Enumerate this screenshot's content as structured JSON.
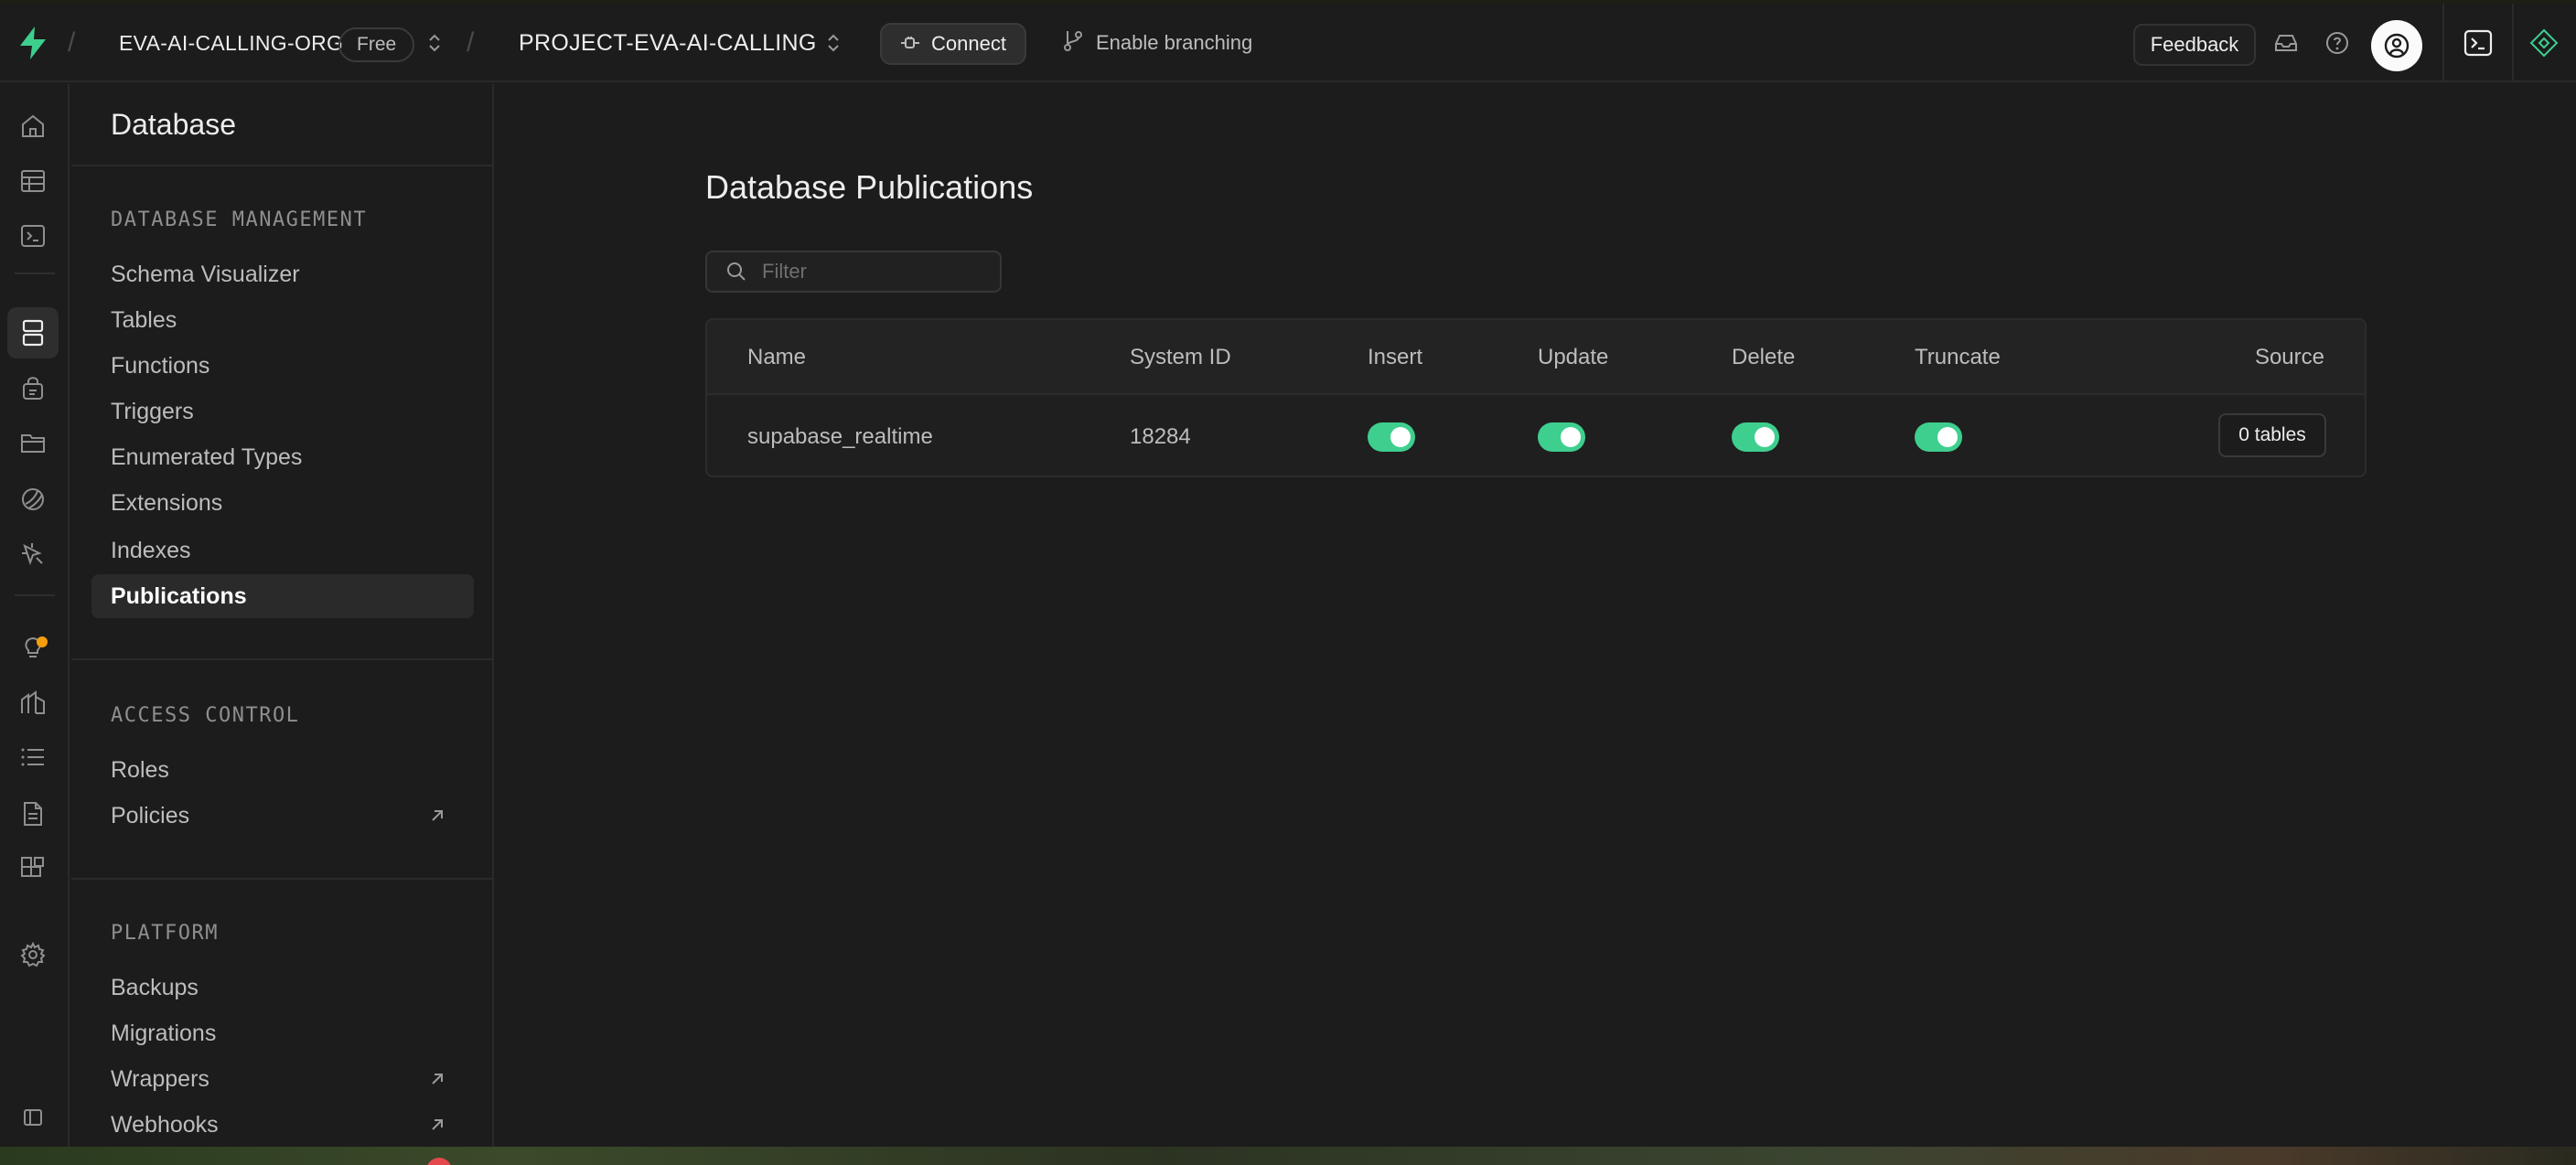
{
  "colors": {
    "accent": "#3ecf8e",
    "notification": "#f59e0b",
    "background": "#1c1c1c"
  },
  "topbar": {
    "org_name": "EVA-AI-CALLING-ORG",
    "plan_badge": "Free",
    "project_name": "PROJECT-EVA-AI-CALLING",
    "connect_label": "Connect",
    "branching_label": "Enable branching",
    "feedback_label": "Feedback"
  },
  "sidebar": {
    "title": "Database",
    "sections": [
      {
        "heading": "DATABASE MANAGEMENT",
        "items": [
          {
            "label": "Schema Visualizer"
          },
          {
            "label": "Tables"
          },
          {
            "label": "Functions"
          },
          {
            "label": "Triggers"
          },
          {
            "label": "Enumerated Types"
          },
          {
            "label": "Extensions"
          },
          {
            "label": "Indexes"
          },
          {
            "label": "Publications",
            "active": true
          }
        ]
      },
      {
        "heading": "ACCESS CONTROL",
        "items": [
          {
            "label": "Roles"
          },
          {
            "label": "Policies",
            "external": true
          }
        ]
      },
      {
        "heading": "PLATFORM",
        "items": [
          {
            "label": "Backups"
          },
          {
            "label": "Migrations"
          },
          {
            "label": "Wrappers",
            "external": true
          },
          {
            "label": "Webhooks",
            "external": true
          }
        ]
      }
    ]
  },
  "main": {
    "title": "Database Publications",
    "filter_placeholder": "Filter",
    "columns": [
      "Name",
      "System ID",
      "Insert",
      "Update",
      "Delete",
      "Truncate",
      "Source"
    ],
    "rows": [
      {
        "name": "supabase_realtime",
        "system_id": "18284",
        "insert": true,
        "update": true,
        "delete": true,
        "truncate": true,
        "source": "0 tables"
      }
    ]
  }
}
